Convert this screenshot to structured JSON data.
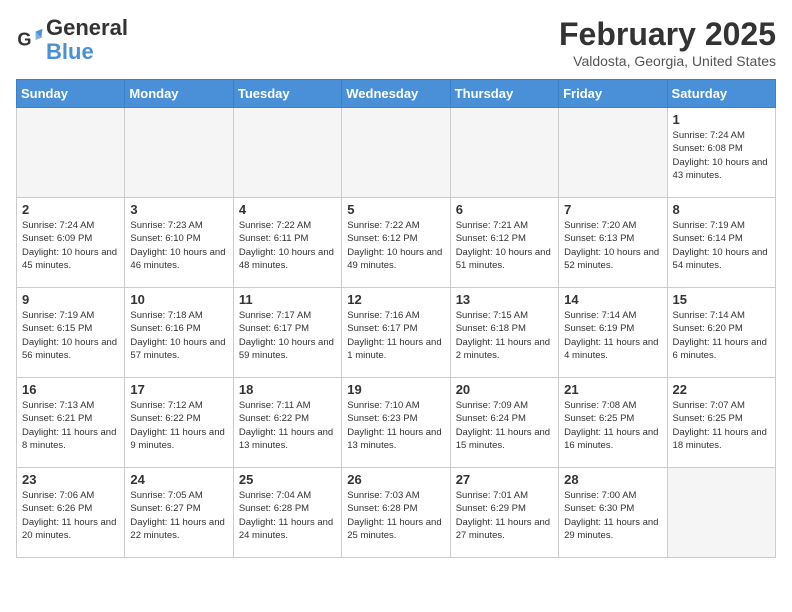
{
  "header": {
    "logo_general": "General",
    "logo_blue": "Blue",
    "month_year": "February 2025",
    "location": "Valdosta, Georgia, United States"
  },
  "days_of_week": [
    "Sunday",
    "Monday",
    "Tuesday",
    "Wednesday",
    "Thursday",
    "Friday",
    "Saturday"
  ],
  "weeks": [
    [
      {
        "day": "",
        "empty": true
      },
      {
        "day": "",
        "empty": true
      },
      {
        "day": "",
        "empty": true
      },
      {
        "day": "",
        "empty": true
      },
      {
        "day": "",
        "empty": true
      },
      {
        "day": "",
        "empty": true
      },
      {
        "day": "1",
        "sunrise": "7:24 AM",
        "sunset": "6:08 PM",
        "daylight": "Daylight: 10 hours and 43 minutes."
      }
    ],
    [
      {
        "day": "2",
        "sunrise": "7:24 AM",
        "sunset": "6:09 PM",
        "daylight": "Daylight: 10 hours and 45 minutes."
      },
      {
        "day": "3",
        "sunrise": "7:23 AM",
        "sunset": "6:10 PM",
        "daylight": "Daylight: 10 hours and 46 minutes."
      },
      {
        "day": "4",
        "sunrise": "7:22 AM",
        "sunset": "6:11 PM",
        "daylight": "Daylight: 10 hours and 48 minutes."
      },
      {
        "day": "5",
        "sunrise": "7:22 AM",
        "sunset": "6:12 PM",
        "daylight": "Daylight: 10 hours and 49 minutes."
      },
      {
        "day": "6",
        "sunrise": "7:21 AM",
        "sunset": "6:12 PM",
        "daylight": "Daylight: 10 hours and 51 minutes."
      },
      {
        "day": "7",
        "sunrise": "7:20 AM",
        "sunset": "6:13 PM",
        "daylight": "Daylight: 10 hours and 52 minutes."
      },
      {
        "day": "8",
        "sunrise": "7:19 AM",
        "sunset": "6:14 PM",
        "daylight": "Daylight: 10 hours and 54 minutes."
      }
    ],
    [
      {
        "day": "9",
        "sunrise": "7:19 AM",
        "sunset": "6:15 PM",
        "daylight": "Daylight: 10 hours and 56 minutes."
      },
      {
        "day": "10",
        "sunrise": "7:18 AM",
        "sunset": "6:16 PM",
        "daylight": "Daylight: 10 hours and 57 minutes."
      },
      {
        "day": "11",
        "sunrise": "7:17 AM",
        "sunset": "6:17 PM",
        "daylight": "Daylight: 10 hours and 59 minutes."
      },
      {
        "day": "12",
        "sunrise": "7:16 AM",
        "sunset": "6:17 PM",
        "daylight": "Daylight: 11 hours and 1 minute."
      },
      {
        "day": "13",
        "sunrise": "7:15 AM",
        "sunset": "6:18 PM",
        "daylight": "Daylight: 11 hours and 2 minutes."
      },
      {
        "day": "14",
        "sunrise": "7:14 AM",
        "sunset": "6:19 PM",
        "daylight": "Daylight: 11 hours and 4 minutes."
      },
      {
        "day": "15",
        "sunrise": "7:14 AM",
        "sunset": "6:20 PM",
        "daylight": "Daylight: 11 hours and 6 minutes."
      }
    ],
    [
      {
        "day": "16",
        "sunrise": "7:13 AM",
        "sunset": "6:21 PM",
        "daylight": "Daylight: 11 hours and 8 minutes."
      },
      {
        "day": "17",
        "sunrise": "7:12 AM",
        "sunset": "6:22 PM",
        "daylight": "Daylight: 11 hours and 9 minutes."
      },
      {
        "day": "18",
        "sunrise": "7:11 AM",
        "sunset": "6:22 PM",
        "daylight": "Daylight: 11 hours and 13 minutes."
      },
      {
        "day": "19",
        "sunrise": "7:10 AM",
        "sunset": "6:23 PM",
        "daylight": "Daylight: 11 hours and 13 minutes."
      },
      {
        "day": "20",
        "sunrise": "7:09 AM",
        "sunset": "6:24 PM",
        "daylight": "Daylight: 11 hours and 15 minutes."
      },
      {
        "day": "21",
        "sunrise": "7:08 AM",
        "sunset": "6:25 PM",
        "daylight": "Daylight: 11 hours and 16 minutes."
      },
      {
        "day": "22",
        "sunrise": "7:07 AM",
        "sunset": "6:25 PM",
        "daylight": "Daylight: 11 hours and 18 minutes."
      }
    ],
    [
      {
        "day": "23",
        "sunrise": "7:06 AM",
        "sunset": "6:26 PM",
        "daylight": "Daylight: 11 hours and 20 minutes."
      },
      {
        "day": "24",
        "sunrise": "7:05 AM",
        "sunset": "6:27 PM",
        "daylight": "Daylight: 11 hours and 22 minutes."
      },
      {
        "day": "25",
        "sunrise": "7:04 AM",
        "sunset": "6:28 PM",
        "daylight": "Daylight: 11 hours and 24 minutes."
      },
      {
        "day": "26",
        "sunrise": "7:03 AM",
        "sunset": "6:28 PM",
        "daylight": "Daylight: 11 hours and 25 minutes."
      },
      {
        "day": "27",
        "sunrise": "7:01 AM",
        "sunset": "6:29 PM",
        "daylight": "Daylight: 11 hours and 27 minutes."
      },
      {
        "day": "28",
        "sunrise": "7:00 AM",
        "sunset": "6:30 PM",
        "daylight": "Daylight: 11 hours and 29 minutes."
      },
      {
        "day": "",
        "empty": true
      }
    ]
  ]
}
